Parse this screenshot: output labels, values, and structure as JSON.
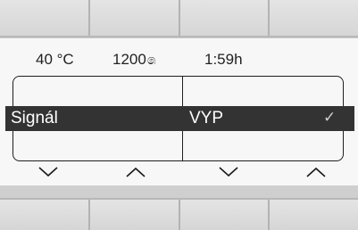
{
  "status": {
    "temperature": "40 °C",
    "spin_speed": "1200",
    "spin_icon": "spin-icon",
    "time": "1:59h"
  },
  "menu": {
    "parameter_label": "Signál",
    "parameter_value": "VYP",
    "confirm_icon": "check-icon"
  },
  "controls": {
    "left_down_icon": "chevron-down-icon",
    "left_up_icon": "chevron-up-icon",
    "right_down_icon": "chevron-down-icon",
    "right_up_icon": "chevron-up-icon"
  },
  "colors": {
    "selection_bg": "#333333",
    "display_bg": "#f7f7f7"
  }
}
